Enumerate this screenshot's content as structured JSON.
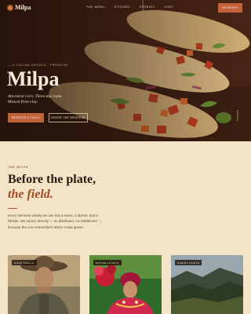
{
  "nav": {
    "brand": "Milpa",
    "links": [
      "The Menu",
      "Kitchen",
      "Stories",
      "Visit"
    ],
    "cta": "Reserve"
  },
  "hero": {
    "kicker": "— A Cocina Oaxaca · Fresh 86",
    "title": "Milpa",
    "subtitle": "Ancestral corn. Three-day mole. Mezcal from clay.",
    "primary_button": "Reserve a Table",
    "secondary_button": "Order the Weekend",
    "scroll_hint": "Scroll"
  },
  "section": {
    "eyebrow": "The Milpa",
    "title_line1": "Before the plate,",
    "title_line2": "the field.",
    "body": "Every heirloom variety we use has a name, a farmer, and a hillside. We source directly — no distributor, no middlemen — because the corn remembers where it was grown."
  },
  "cards": [
    {
      "tag": "Doña Amalia"
    },
    {
      "tag": "Estrella Ruiz"
    },
    {
      "tag": "Sierra Norte"
    }
  ],
  "colors": {
    "accent": "#c0623a",
    "background": "#f3e4c7",
    "title_italic": "#a44b24"
  }
}
